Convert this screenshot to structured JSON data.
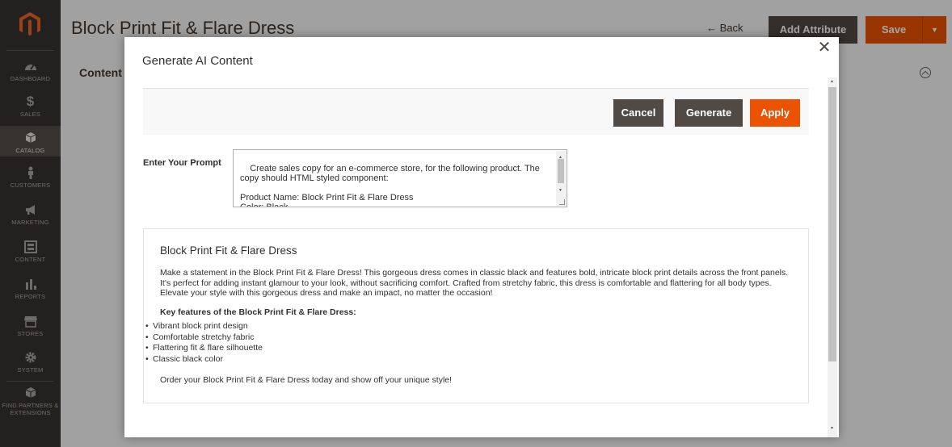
{
  "header": {
    "page_title": "Block Print Fit & Flare Dress",
    "back_label": "← Back",
    "add_attribute_label": "Add Attribute",
    "save_label": "Save",
    "section_label": "Content"
  },
  "sidebar": {
    "items": [
      {
        "label": "DASHBOARD",
        "icon": "dashboard-icon"
      },
      {
        "label": "SALES",
        "icon": "dollar-icon"
      },
      {
        "label": "CATALOG",
        "icon": "cube-icon"
      },
      {
        "label": "CUSTOMERS",
        "icon": "person-icon"
      },
      {
        "label": "MARKETING",
        "icon": "megaphone-icon"
      },
      {
        "label": "CONTENT",
        "icon": "layout-icon"
      },
      {
        "label": "REPORTS",
        "icon": "bar-chart-icon"
      },
      {
        "label": "STORES",
        "icon": "store-icon"
      },
      {
        "label": "SYSTEM",
        "icon": "gear-icon"
      },
      {
        "label": "FIND PARTNERS & EXTENSIONS",
        "icon": "box-icon"
      }
    ],
    "active": "CATALOG"
  },
  "modal": {
    "title": "Generate AI Content",
    "cancel_label": "Cancel",
    "generate_label": "Generate",
    "apply_label": "Apply",
    "prompt_label": "Enter Your Prompt",
    "prompt_value": "Create sales copy for an e-commerce store, for the following product. The copy should HTML styled component:\n\nProduct Name: Block Print Fit & Flare Dress\nColor: Black",
    "result": {
      "heading": "Block Print Fit & Flare Dress",
      "description": "Make a statement in the Block Print Fit & Flare Dress! This gorgeous dress comes in classic black and features bold, intricate block print details across the front panels. It's perfect for adding instant glamour to your look, without sacrificing comfort. Crafted from stretchy fabric, this dress is comfortable and flattering for all body types. Elevate your style with this gorgeous dress and make an impact, no matter the occasion!",
      "features_heading": "Key features of the Block Print Fit & Flare Dress:",
      "features": [
        "Vibrant block print design",
        "Comfortable stretchy fabric",
        "Flattering fit & flare silhouette",
        "Classic black color"
      ],
      "cta": "Order your Block Print Fit & Flare Dress today and show off your unique style!"
    }
  },
  "colors": {
    "primary_dark": "#514943",
    "accent_orange": "#eb5202",
    "sidebar_bg": "#373330"
  }
}
